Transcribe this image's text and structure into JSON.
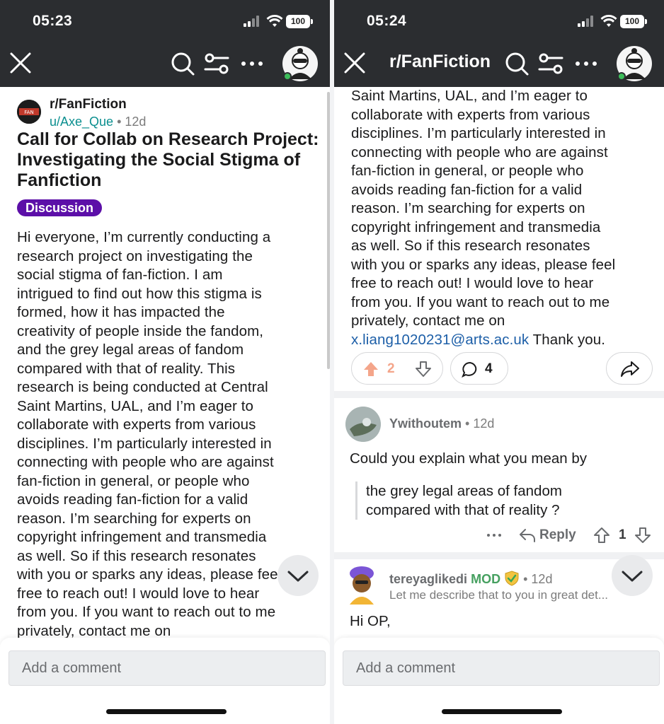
{
  "colors": {
    "header_bg": "#2b2d30",
    "flair_bg": "#5c0fa8",
    "author": "#0b8f8f",
    "email_link": "#1d5fa8",
    "upvote": "#f4a58a",
    "mod_green": "#46a060"
  },
  "status_bar": {
    "left_time": "05:23",
    "right_time": "05:24",
    "battery": "100"
  },
  "left": {
    "nav": {
      "icons": [
        "close-icon",
        "search-icon",
        "filter-icon",
        "more-icon",
        "avatar"
      ]
    },
    "post": {
      "subreddit": "r/FanFiction",
      "author": "u/Axe_Que",
      "age": "12d",
      "title": "Call for Collab on Research Project: Investigating the Social Stigma of Fanfiction",
      "flair": "Discussion",
      "body_lines": [
        "Hi everyone, I’m currently conducting a",
        "research project on investigating the",
        "social stigma of fan-fiction. I am",
        "intrigued to find out how this stigma is",
        "formed, how it has impacted the",
        "creativity of people inside the fandom,",
        "and the grey legal areas of fandom",
        "compared with that of reality. This",
        "research is being conducted at Central",
        "Saint Martins, UAL, and I’m eager to",
        "collaborate with experts from various",
        "disciplines. I’m particularly interested in",
        "connecting with people who are against",
        "fan-fiction in general, or people who",
        "avoids reading fan-fiction for a valid",
        "reason. I’m searching for experts on",
        "copyright infringement and transmedia",
        "as well. So if this research resonates",
        "with you or sparks any ideas, please feel",
        "free to reach out!  I would love to hear",
        "from you. If you want to reach out to me",
        "privately, contact me on"
      ]
    },
    "comment_placeholder": "Add a comment"
  },
  "right": {
    "nav": {
      "subreddit_title": "r/FanFiction"
    },
    "body_lines": [
      "Saint Martins, UAL, and I’m eager to",
      "collaborate with experts from various",
      "disciplines. I’m particularly interested in",
      "connecting with people who are against",
      "fan-fiction in general, or people who",
      "avoids reading fan-fiction for a valid",
      "reason. I’m searching for experts on",
      "copyright infringement and transmedia",
      "as well. So if this research resonates",
      "with you or sparks any ideas, please feel",
      "free to reach out!  I would love to hear",
      "from you. If you want to reach out to me",
      "privately, contact me on"
    ],
    "email": "x.liang1020231@arts.ac.uk",
    "after_email": " Thank you.",
    "votes": "2",
    "comments_count": "4",
    "comment1": {
      "user": "Ywithoutem",
      "age": "12d",
      "text": "Could you explain what you mean by",
      "quote_lines": [
        "the grey legal areas of fandom",
        "compared with that of reality ?"
      ],
      "reply_label": "Reply",
      "votes": "1"
    },
    "comment2": {
      "user": "tereyaglikedi",
      "mod_label": "MOD",
      "age": "12d",
      "preview": "Let me describe that to you in great det...",
      "text": "Hi OP,"
    },
    "comment_placeholder": "Add a comment"
  }
}
